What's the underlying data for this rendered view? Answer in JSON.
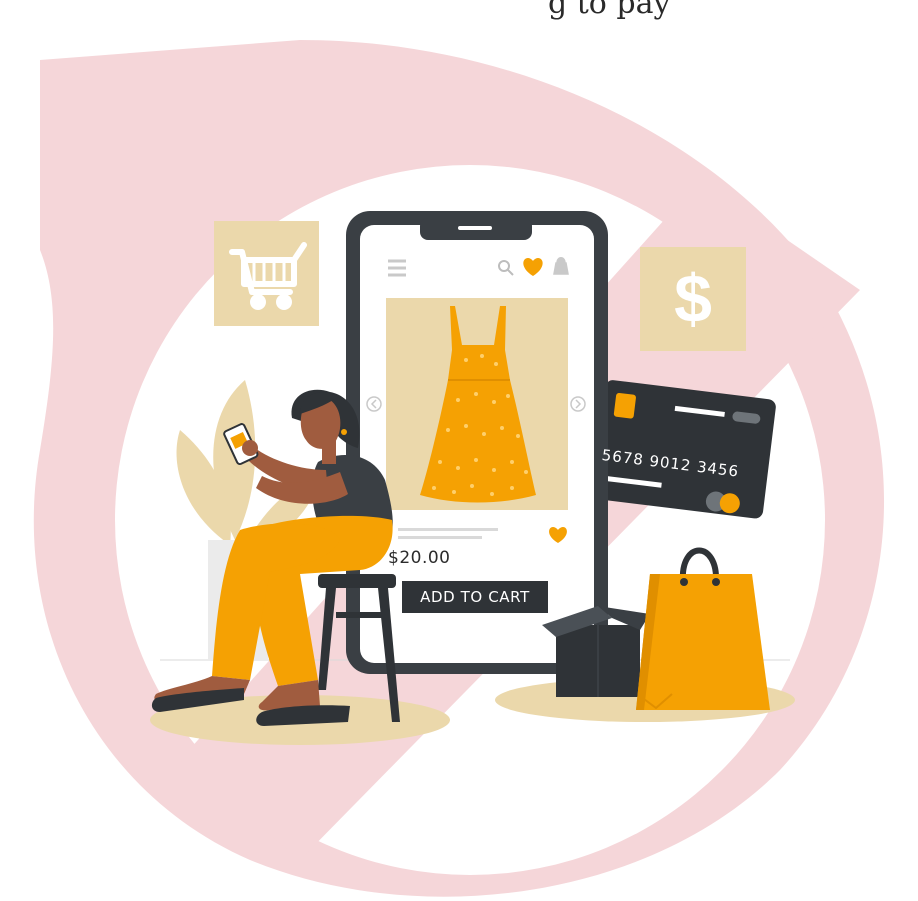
{
  "header_fragment": "g to pay",
  "product": {
    "price": "$20.00",
    "add_to_cart_label": "ADD TO CART"
  },
  "credit_card": {
    "number": "5678 9012 3456"
  },
  "currency_badge": {
    "symbol": "$"
  },
  "icons": [
    "menu-icon",
    "search-icon",
    "heart-icon",
    "bag-icon",
    "cart-icon",
    "dollar-icon",
    "prev-arrow-icon",
    "next-arrow-icon"
  ],
  "colors": {
    "accent_orange": "#f5a103",
    "beige": "#ebd8ab",
    "dark": "#3a3f44",
    "watermark_pink": "#f5d6d9"
  }
}
